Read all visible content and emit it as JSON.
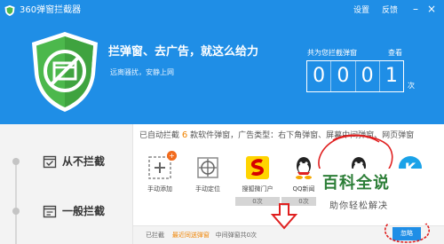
{
  "window": {
    "title": "360弹窗拦截器",
    "settings_label": "设置",
    "feedback_label": "反馈",
    "minimize_glyph": "–",
    "close_glyph": "×"
  },
  "hero": {
    "headline": "拦弹窗、去广告，就这么给力",
    "subline": "远离骚扰，安静上网",
    "counter_label": "共为您拦截弹窗",
    "view_link": "查看",
    "digits": [
      "0",
      "0",
      "0",
      "1"
    ],
    "unit": "次"
  },
  "sidebar": {
    "items": [
      {
        "label": "从不拦截",
        "icon": "calendar-check-icon"
      },
      {
        "label": "一般拦截",
        "icon": "calendar-icon"
      }
    ]
  },
  "summary": {
    "prefix": "已自动拦截",
    "count": "6",
    "suffix": "款软件弹窗，广告类型：右下角弹窗、屏幕中间弹窗、网页弹窗"
  },
  "apps": [
    {
      "name": "手动添加",
      "icon": "add-icon",
      "count": ""
    },
    {
      "name": "手动定位",
      "icon": "crosshair-icon",
      "count": ""
    },
    {
      "name": "搜狐微门户",
      "icon": "sohu-icon",
      "count": "0次"
    },
    {
      "name": "QQ新闻",
      "icon": "qq-icon",
      "count": "0次"
    },
    {
      "name": "",
      "icon": "qq-icon",
      "count": ""
    },
    {
      "name": "",
      "icon": "kugou-icon",
      "count": ""
    }
  ],
  "bottom": {
    "blocked_label": "已拦截",
    "recent_label": "最近同送弹窗",
    "middle_label": "中间弹窗共0次",
    "ignore_label": "忽略"
  },
  "watermark": {
    "title": "百科全说",
    "subtitle": "助你轻松解决"
  },
  "colors": {
    "header_blue": "#1f8ee6",
    "shield_green": "#4cb84c",
    "accent_orange": "#f08300",
    "annotation_red": "#e02020",
    "watermark_green": "#2c7e37"
  }
}
